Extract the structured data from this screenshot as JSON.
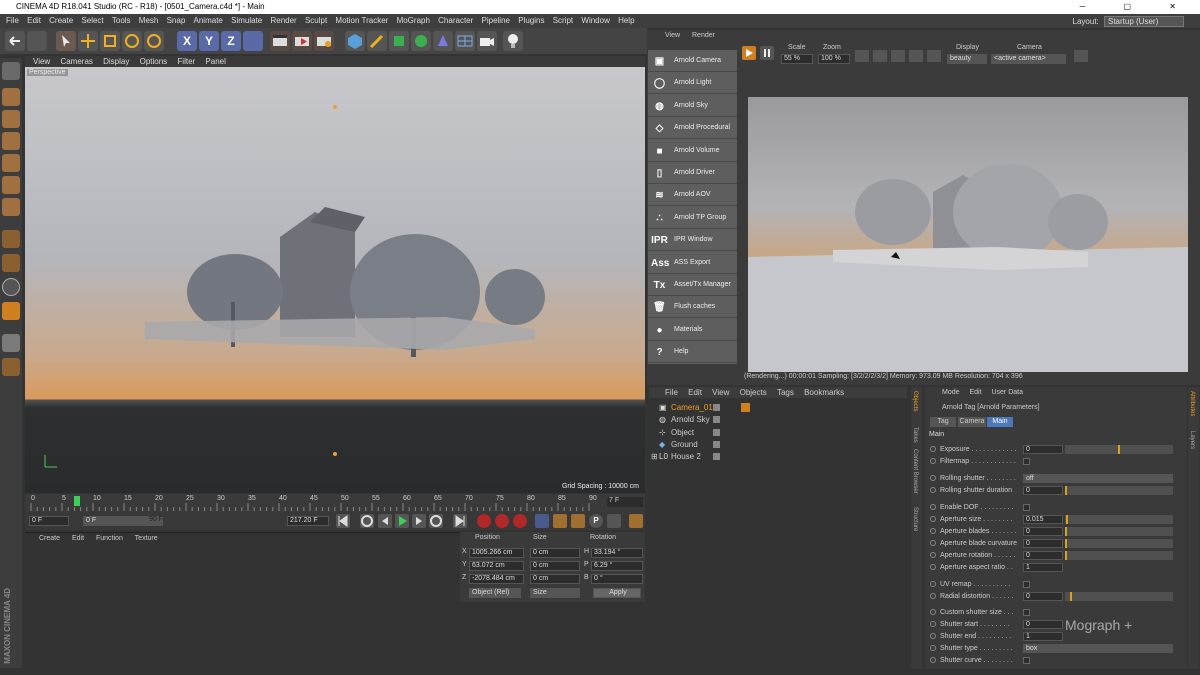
{
  "titlebar": {
    "title": "CINEMA 4D R18.041 Studio (RC - R18) - [0501_Camera.c4d *] - Main"
  },
  "menu": [
    "File",
    "Edit",
    "Create",
    "Select",
    "Tools",
    "Mesh",
    "Snap",
    "Animate",
    "Simulate",
    "Render",
    "Sculpt",
    "Motion Tracker",
    "MoGraph",
    "Character",
    "Pipeline",
    "Plugins",
    "Script",
    "Window",
    "Help"
  ],
  "layout": {
    "label": "Layout:",
    "value": "Startup (User)"
  },
  "viewport": {
    "menu": [
      "View",
      "Cameras",
      "Display",
      "Options",
      "Filter",
      "Panel"
    ],
    "label": "Perspective",
    "grid_spacing": "Grid Spacing : 10000 cm"
  },
  "timeline": {
    "ticks": [
      "0",
      "5",
      "10",
      "15",
      "20",
      "25",
      "30",
      "35",
      "40",
      "45",
      "50",
      "55",
      "60",
      "65",
      "70",
      "75",
      "80",
      "85",
      "90"
    ],
    "end_frame": "7 F",
    "start_field": "0 F",
    "cur_field": "0 F",
    "max_field": "90 F",
    "fps_field": "217.20 F"
  },
  "material_manager": {
    "menu": [
      "Create",
      "Edit",
      "Function",
      "Texture"
    ]
  },
  "coords": {
    "headers": [
      "Position",
      "Size",
      "Rotation"
    ],
    "rows": [
      {
        "axis": "X",
        "pos": "1005.266 cm",
        "size": "0 cm",
        "rlabel": "H",
        "rot": "33.194 °"
      },
      {
        "axis": "Y",
        "pos": "63.072 cm",
        "size": "0 cm",
        "rlabel": "P",
        "rot": "6.29 °"
      },
      {
        "axis": "Z",
        "pos": "-2078.484 cm",
        "size": "0 cm",
        "rlabel": "B",
        "rot": "0 °"
      }
    ],
    "mode": "Object (Rel)",
    "size_mode": "Size",
    "apply": "Apply"
  },
  "render_view": {
    "menu": [
      "View",
      "Render"
    ],
    "scale_label": "Scale",
    "scale": "55 %",
    "zoom_label": "Zoom",
    "zoom": "100 %",
    "display_label": "Display",
    "display": "beauty",
    "camera_label": "Camera",
    "camera": "<active camera>",
    "status": "(Rendering...)  00:00:01  Sampling: [3/2/2/2/3/2]  Memory: 973.09 MB  Resolution: 704 x 396"
  },
  "arnold_menu": [
    {
      "icon": "camera-icon",
      "glyph": "▣",
      "label": "Arnold Camera"
    },
    {
      "icon": "light-bulb-icon",
      "glyph": "◯",
      "label": "Arnold Light"
    },
    {
      "icon": "sky-globe-icon",
      "glyph": "◍",
      "label": "Arnold Sky"
    },
    {
      "icon": "procedural-cube-icon",
      "glyph": "◇",
      "label": "Arnold Procedural"
    },
    {
      "icon": "volume-cube-icon",
      "glyph": "■",
      "label": "Arnold Volume"
    },
    {
      "icon": "driver-document-icon",
      "glyph": "▯",
      "label": "Arnold Driver"
    },
    {
      "icon": "aov-layers-icon",
      "glyph": "≋",
      "label": "Arnold AOV"
    },
    {
      "icon": "tp-group-dots-icon",
      "glyph": "∴",
      "label": "Arnold TP Group"
    },
    {
      "icon": "ipr-icon",
      "glyph": "IPR",
      "label": "IPR Window"
    },
    {
      "icon": "ass-icon",
      "glyph": "Ass",
      "label": "ASS Export"
    },
    {
      "icon": "tx-icon",
      "glyph": "Tx",
      "label": "Asset/Tx Manager"
    },
    {
      "icon": "trash-icon",
      "glyph": "🗑",
      "label": "Flush caches"
    },
    {
      "icon": "material-sphere-icon",
      "glyph": "●",
      "label": "Materials"
    },
    {
      "icon": "help-icon",
      "glyph": "?",
      "label": "Help"
    }
  ],
  "object_manager": {
    "menu": [
      "File",
      "Edit",
      "View",
      "Objects",
      "Tags",
      "Bookmarks"
    ],
    "objects": [
      "Camera_01",
      "Arnold Sky",
      "Object",
      "Ground",
      "House 2"
    ]
  },
  "attributes": {
    "menu": [
      "Mode",
      "Edit",
      "User Data"
    ],
    "title": "Arnold Tag [Arnold Parameters]",
    "tabs": [
      "Tag",
      "Camera",
      "Main"
    ],
    "section": "Main",
    "params": [
      {
        "label": "Exposure . . . . . . . . . . . .",
        "value": "0",
        "level": 0.5
      },
      {
        "label": "Filtermap . . . . . . . . . . . .",
        "value": "",
        "level": null
      },
      {
        "label": "Rolling shutter . . . . . . . .",
        "value": "off",
        "level": null
      },
      {
        "label": "Rolling shutter duration",
        "value": "0",
        "level": 0
      },
      {
        "label": "Enable DOF . . . . . . . . .",
        "value": "",
        "level": null
      },
      {
        "label": "Aperture size . . . . . . . .",
        "value": "0.015",
        "level": 0.01
      },
      {
        "label": "Aperture blades . . . . . . .",
        "value": "0",
        "level": 0
      },
      {
        "label": "Aperture blade curvature",
        "value": "0",
        "level": 0
      },
      {
        "label": "Aperture rotation . . . . . .",
        "value": "0",
        "level": 0
      },
      {
        "label": "Aperture aspect ratio . .",
        "value": "1",
        "level": null
      },
      {
        "label": "UV remap . . . . . . . . . .",
        "value": "",
        "level": null
      },
      {
        "label": "Radial distortion . . . . . .",
        "value": "0",
        "level": 0.05
      },
      {
        "label": "Custom shutter size . . .",
        "value": "",
        "level": null
      },
      {
        "label": "Shutter start . . . . . . . .",
        "value": "0",
        "level": null
      },
      {
        "label": "Shutter end . . . . . . . . .",
        "value": "1",
        "level": null
      },
      {
        "label": "Shutter type . . . . . . . . .",
        "value": "box",
        "level": null
      },
      {
        "label": "Shutter curve . . . . . . . .",
        "value": "",
        "level": null
      }
    ]
  },
  "right_vtabs": [
    "Objects",
    "Takes",
    "Content Browser",
    "Structure"
  ],
  "far_vtabs": [
    "Attributes",
    "Layers"
  ],
  "brand": "MAXON CINEMA 4D",
  "watermark": "Mograph +"
}
